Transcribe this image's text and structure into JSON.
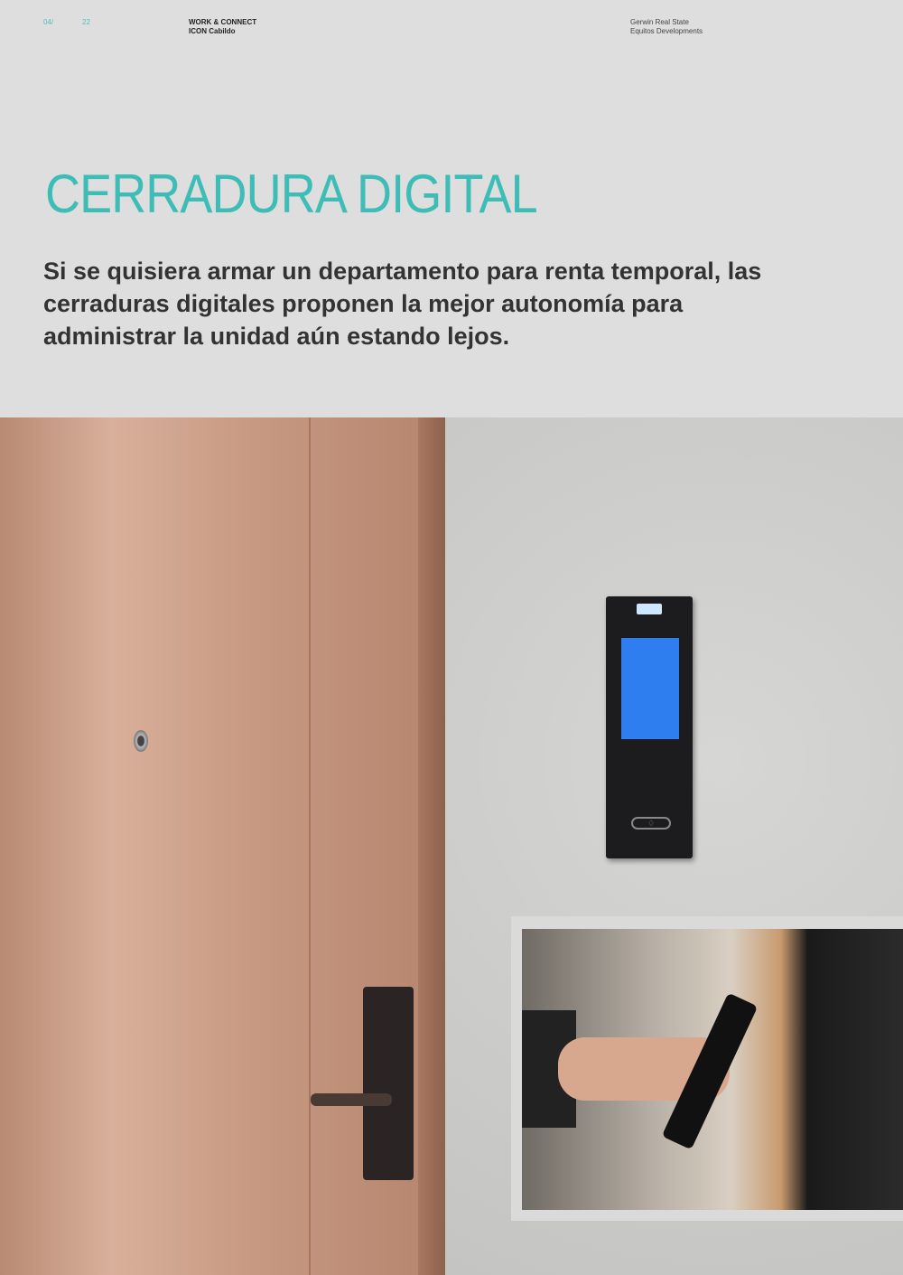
{
  "header": {
    "page_prefix": "04/",
    "page_number": "22",
    "project_line1": "WORK & CONNECT",
    "project_line2": "ICON Cabildo",
    "company_line1": "Gerwin Real State",
    "company_line2": "Equitos Developments"
  },
  "title": "CERRADURA DIGITAL",
  "lead": "Si se quisiera armar un departamento para renta temporal, las cerraduras digitales proponen la mejor autonomía para administrar la unidad aún estando lejos.",
  "colors": {
    "accent": "#3dbdb6",
    "background": "#dedede",
    "text": "#333333"
  }
}
